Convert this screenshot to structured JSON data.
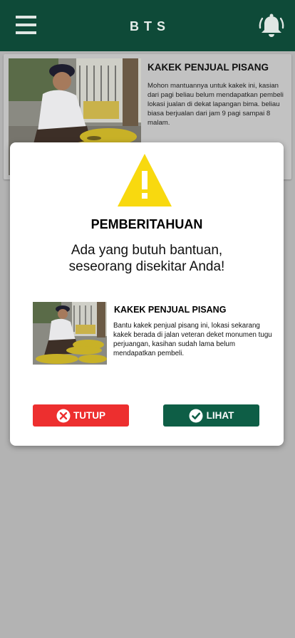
{
  "header": {
    "title": "BTS",
    "menu_icon": "hamburger-menu-icon",
    "notification_icon": "bell-icon"
  },
  "feed": {
    "card": {
      "title": "KAKEK PENJUAL PISANG",
      "description": "Mohon mantuannya untuk kakek ini, kasian dari pagi beliau belum mendapatkan pembeli lokasi jualan di dekat lapangan bima. beliau biasa berjualan dari jam 9 pagi sampai 8 malam."
    }
  },
  "modal": {
    "icon": "warning-icon",
    "title": "PEMBERITAHUAN",
    "message_line1": "Ada yang butuh bantuan,",
    "message_line2": "seseorang disekitar Anda!",
    "item": {
      "title": "KAKEK PENJUAL PISANG",
      "description": "Bantu kakek penjual pisang ini, lokasi sekarang kakek berada di jalan veteran deket monumen tugu perjuangan, kasihan sudah lama belum mendapatkan pembeli."
    },
    "buttons": {
      "close_label": "TUTUP",
      "see_label": "LIHAT"
    }
  },
  "colors": {
    "header_bg": "#0e4a38",
    "close_button": "#ed2f2f",
    "see_button": "#0e5e46",
    "warning_yellow": "#f8d90f",
    "overlay": "#b3b3b3"
  }
}
